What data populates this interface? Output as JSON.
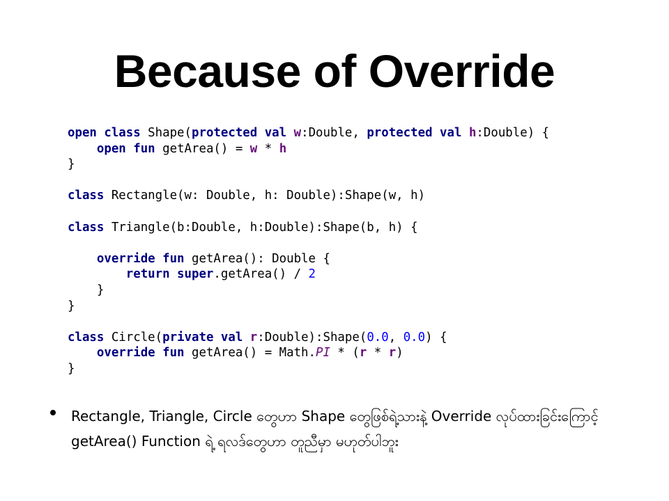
{
  "slide": {
    "title": "Because of Override",
    "code_lines": [
      [
        {
          "t": "open class",
          "c": "kw"
        },
        {
          "t": " Shape(",
          "c": "plain"
        },
        {
          "t": "protected val",
          "c": "kw"
        },
        {
          "t": " ",
          "c": "plain"
        },
        {
          "t": "w",
          "c": "prop"
        },
        {
          "t": ":Double, ",
          "c": "plain"
        },
        {
          "t": "protected val",
          "c": "kw"
        },
        {
          "t": " ",
          "c": "plain"
        },
        {
          "t": "h",
          "c": "prop"
        },
        {
          "t": ":Double) {",
          "c": "plain"
        }
      ],
      [
        {
          "t": "    ",
          "c": "plain"
        },
        {
          "t": "open fun",
          "c": "kw"
        },
        {
          "t": " getArea() = ",
          "c": "plain"
        },
        {
          "t": "w",
          "c": "prop"
        },
        {
          "t": " * ",
          "c": "plain"
        },
        {
          "t": "h",
          "c": "prop"
        }
      ],
      [
        {
          "t": "}",
          "c": "plain"
        }
      ],
      [],
      [
        {
          "t": "class",
          "c": "kw"
        },
        {
          "t": " Rectangle(w: Double, h: Double):Shape(w, h)",
          "c": "plain"
        }
      ],
      [],
      [
        {
          "t": "class",
          "c": "kw"
        },
        {
          "t": " Triangle(b:Double, h:Double):Shape(b, h) {",
          "c": "plain"
        }
      ],
      [],
      [
        {
          "t": "    ",
          "c": "plain"
        },
        {
          "t": "override fun",
          "c": "kw"
        },
        {
          "t": " getArea(): Double {",
          "c": "plain"
        }
      ],
      [
        {
          "t": "        ",
          "c": "plain"
        },
        {
          "t": "return super",
          "c": "kw"
        },
        {
          "t": ".getArea() / ",
          "c": "plain"
        },
        {
          "t": "2",
          "c": "num"
        }
      ],
      [
        {
          "t": "    }",
          "c": "plain"
        }
      ],
      [
        {
          "t": "}",
          "c": "plain"
        }
      ],
      [],
      [
        {
          "t": "class",
          "c": "kw"
        },
        {
          "t": " Circle(",
          "c": "plain"
        },
        {
          "t": "private val",
          "c": "kw"
        },
        {
          "t": " ",
          "c": "plain"
        },
        {
          "t": "r",
          "c": "prop"
        },
        {
          "t": ":Double):Shape(",
          "c": "plain"
        },
        {
          "t": "0.0",
          "c": "num"
        },
        {
          "t": ", ",
          "c": "plain"
        },
        {
          "t": "0.0",
          "c": "num"
        },
        {
          "t": ") {",
          "c": "plain"
        }
      ],
      [
        {
          "t": "    ",
          "c": "plain"
        },
        {
          "t": "override fun",
          "c": "kw"
        },
        {
          "t": " getArea() = Math.",
          "c": "plain"
        },
        {
          "t": "PI",
          "c": "italic"
        },
        {
          "t": " * (",
          "c": "plain"
        },
        {
          "t": "r",
          "c": "prop"
        },
        {
          "t": " * ",
          "c": "plain"
        },
        {
          "t": "r",
          "c": "prop"
        },
        {
          "t": ")",
          "c": "plain"
        }
      ],
      [
        {
          "t": "}",
          "c": "plain"
        }
      ]
    ],
    "bullet_text": "Rectangle, Triangle, Circle တွေဟာ Shape တွေဖြစ်ရဲ့သားနဲ့ Override လုပ်ထားခြင်းကြောင့် getArea() Function ရဲ့ ရလဒ်တွေဟာ တူညီမှာ မဟုတ်ပါဘူး"
  },
  "colors": {
    "background": "#ffffff",
    "keyword": "#000080",
    "property": "#660e7a",
    "number": "#0000ff",
    "text": "#000000"
  }
}
